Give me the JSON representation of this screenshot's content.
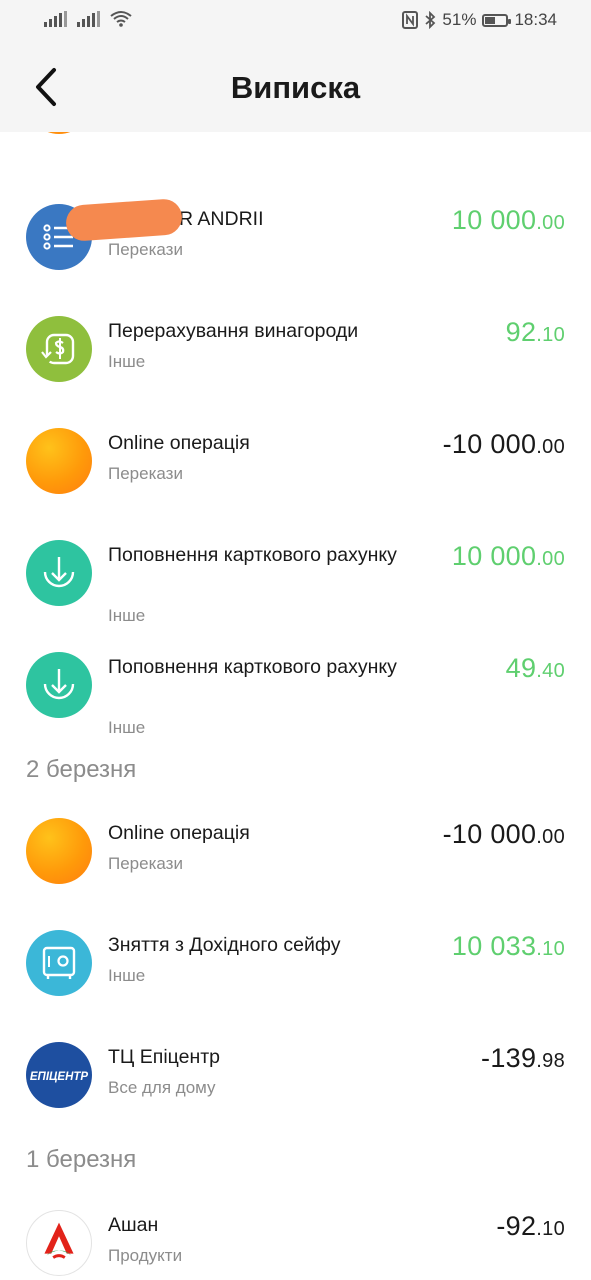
{
  "status_bar": {
    "battery": "51%",
    "time": "18:34",
    "battery_level": 0.51
  },
  "header": {
    "title": "Виписка",
    "back_icon": "chevron-left-icon"
  },
  "sections": {
    "d0": {
      "items": [
        {
          "name": "",
          "category": "",
          "amount_int": "",
          "amount_frac": "",
          "icon": "orange-circle"
        },
        {
          "name": "ER ANDRII",
          "category": "Перекази",
          "amount_int": "10 000",
          "amount_frac": ".00",
          "icon": "list-icon",
          "color": "#3a78c2"
        },
        {
          "name": "Перерахування винагороди",
          "category": "Інше",
          "amount_int": "92",
          "amount_frac": ".10",
          "icon": "cashback-icon",
          "color": "#8fbf3d"
        },
        {
          "name": "Online операція",
          "category": "Перекази",
          "amount_int": "-10 000",
          "amount_frac": ".00",
          "icon": "orange-circle"
        },
        {
          "name": "Поповнення карткового рахунку",
          "category": "Інше",
          "amount_int": "10 000",
          "amount_frac": ".00",
          "icon": "download-icon",
          "color": "#2ec4a0"
        },
        {
          "name": "Поповнення карткового рахунку",
          "category": "Інше",
          "amount_int": "49",
          "amount_frac": ".40",
          "icon": "download-icon",
          "color": "#2ec4a0"
        }
      ]
    },
    "d1": {
      "date": "2 березня",
      "items": [
        {
          "name": "Online операція",
          "category": "Перекази",
          "amount_int": "-10 000",
          "amount_frac": ".00",
          "icon": "orange-circle"
        },
        {
          "name": "Зняття з Дохідного сейфу",
          "category": "Інше",
          "amount_int": "10 033",
          "amount_frac": ".10",
          "icon": "safe-icon",
          "color": "#3bb7d8"
        },
        {
          "name": "ТЦ Епіцентр",
          "category": "Все для дому",
          "amount_int": "-139",
          "amount_frac": ".98",
          "icon": "epicentr-logo",
          "color": "#1e4fa0",
          "logo_text": "ЕПІЦЕНТР"
        }
      ]
    },
    "d2": {
      "date": "1 березня",
      "items": [
        {
          "name": "Ашан",
          "category": "Продукти",
          "amount_int": "-92",
          "amount_frac": ".10",
          "icon": "auchan-logo"
        }
      ]
    }
  },
  "colors": {
    "positive": "#5fcf6f",
    "negative": "#1a1a1a",
    "muted": "#8c8c8c",
    "header_bg": "#f5f5f5"
  }
}
